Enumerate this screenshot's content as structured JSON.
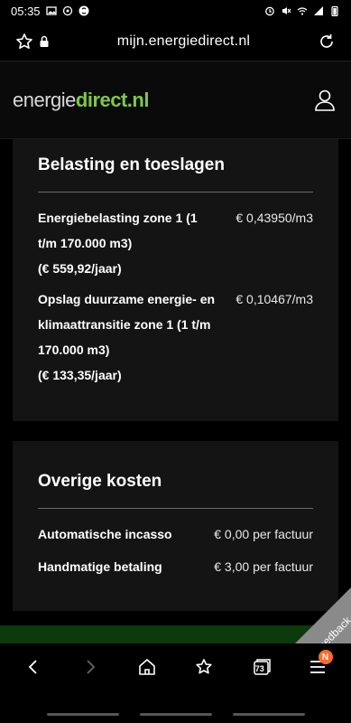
{
  "status": {
    "time": "05:35"
  },
  "browser": {
    "url": "mijn.energiedirect.nl"
  },
  "header": {
    "logo_part1": "energie",
    "logo_part2": "direct.nl"
  },
  "taxes": {
    "title": "Belasting en toeslagen",
    "rows": [
      {
        "label": "Energiebelasting zone 1 (1 t/m 170.000 m3)",
        "sub": "(€ 559,92/jaar)",
        "value": "€ 0,43950/m3"
      },
      {
        "label": "Opslag duurzame energie- en klimaattransitie zone 1 (1 t/m 170.000 m3)",
        "sub": "(€ 133,35/jaar)",
        "value": "€ 0,10467/m3"
      }
    ]
  },
  "other": {
    "title": "Overige kosten",
    "rows": [
      {
        "label": "Automatische incasso",
        "value": "€ 0,00 per factuur"
      },
      {
        "label": "Handmatige betaling",
        "value": "€ 3,00 per factuur"
      }
    ]
  },
  "feedback": {
    "label": "Feedback"
  },
  "nav": {
    "tab_count": "73",
    "badge": "N"
  }
}
